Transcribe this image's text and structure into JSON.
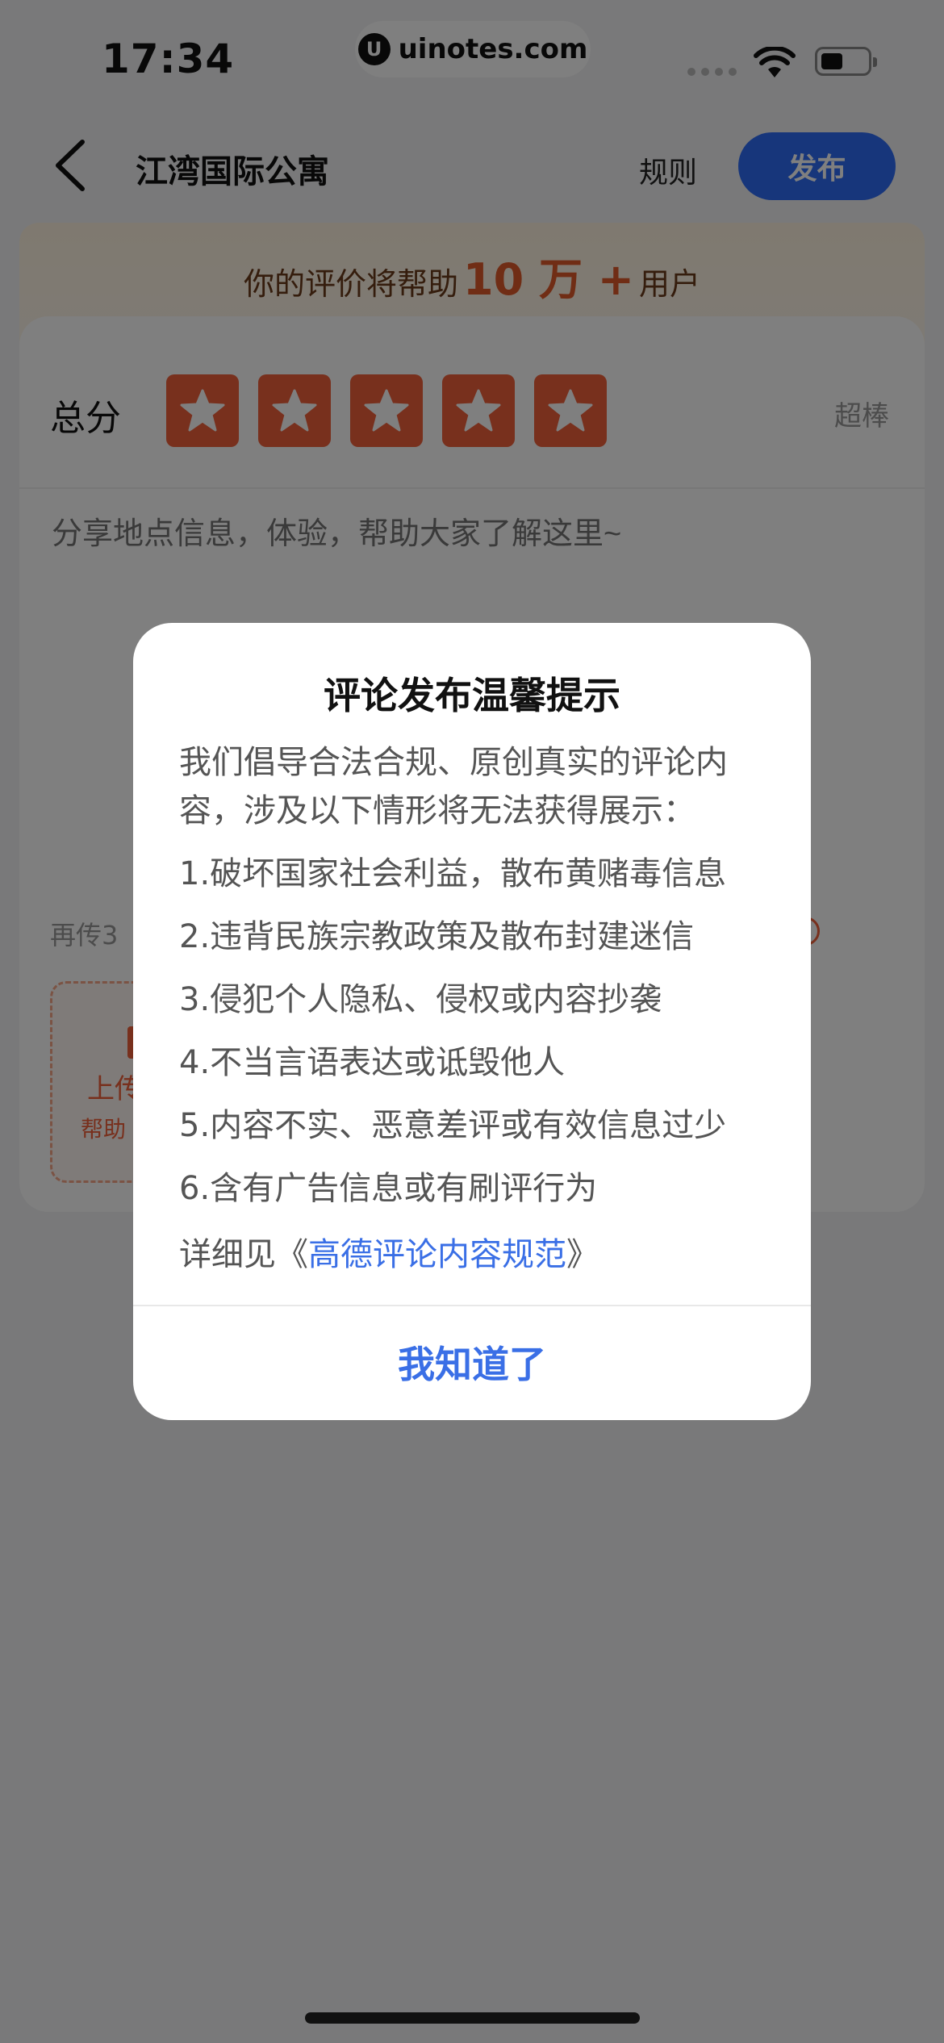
{
  "status_bar": {
    "time": "17:34",
    "watermark": "uinotes.com",
    "watermark_logo": "U"
  },
  "header": {
    "title": "江湾国际公寓",
    "rules_label": "规则",
    "publish_label": "发布"
  },
  "banner": {
    "prefix": "你的评价将帮助",
    "highlight": "10 万 +",
    "suffix": "用户"
  },
  "rating": {
    "label": "总分",
    "star_count": 5,
    "value": 5,
    "description": "超棒"
  },
  "review": {
    "placeholder": "分享地点信息，体验，帮助大家了解这里~"
  },
  "upload": {
    "hint": "再传3",
    "label": "上传",
    "sub_label": "帮助"
  },
  "dialog": {
    "title": "评论发布温馨提示",
    "intro": "我们倡导合法合规、原创真实的评论内容，涉及以下情形将无法获得展示：",
    "rules": [
      "1.破坏国家社会利益，散布黄赌毒信息",
      "2.违背民族宗教政策及散布封建迷信",
      "3.侵犯个人隐私、侵权或内容抄袭",
      "4.不当言语表达或诋毁他人",
      "5.内容不实、恶意差评或有效信息过少",
      "6.含有广告信息或有刷评行为"
    ],
    "detail_prefix": "详细见《",
    "detail_link": "高德评论内容规范",
    "detail_suffix": "》",
    "confirm_label": "我知道了"
  },
  "colors": {
    "accent": "#2f6df6",
    "star": "#f0603a",
    "link": "#3a6fe6",
    "overlay": "rgba(0,0,0,0.5)"
  }
}
